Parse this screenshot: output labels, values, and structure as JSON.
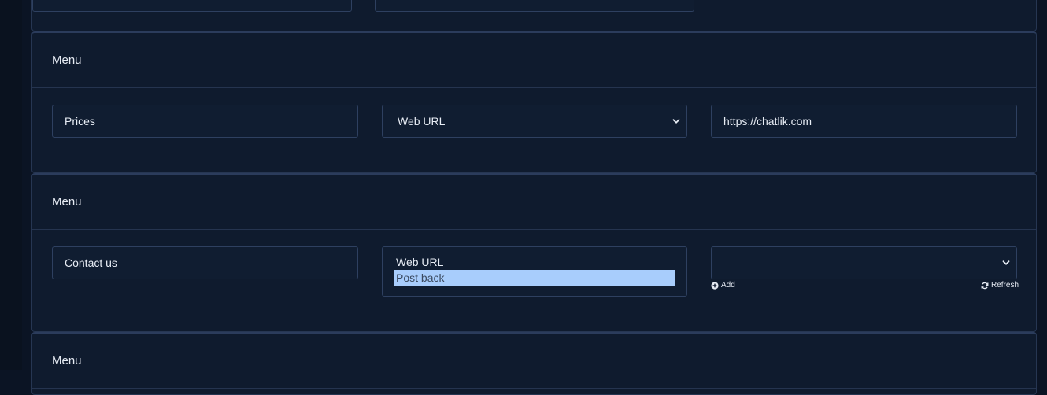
{
  "cards": [
    {
      "header": "Menu",
      "title_value": "Prices",
      "type_value": "Web URL",
      "url_value": "https://chatlik.com"
    },
    {
      "header": "Menu",
      "title_value": "Contact us",
      "type_options": [
        "Web URL",
        "Post back"
      ],
      "selected_option": "Post back",
      "postback_value": "",
      "add_label": "Add",
      "refresh_label": "Refresh"
    },
    {
      "header": "Menu"
    }
  ],
  "icons": {
    "add": "plus-circle-icon",
    "refresh": "refresh-icon",
    "dropdown": "chevron-down-icon"
  },
  "colors": {
    "background": "#0b1424",
    "card": "#0f1b2e",
    "border": "#2e4060",
    "highlight": "#a8cdfc"
  }
}
